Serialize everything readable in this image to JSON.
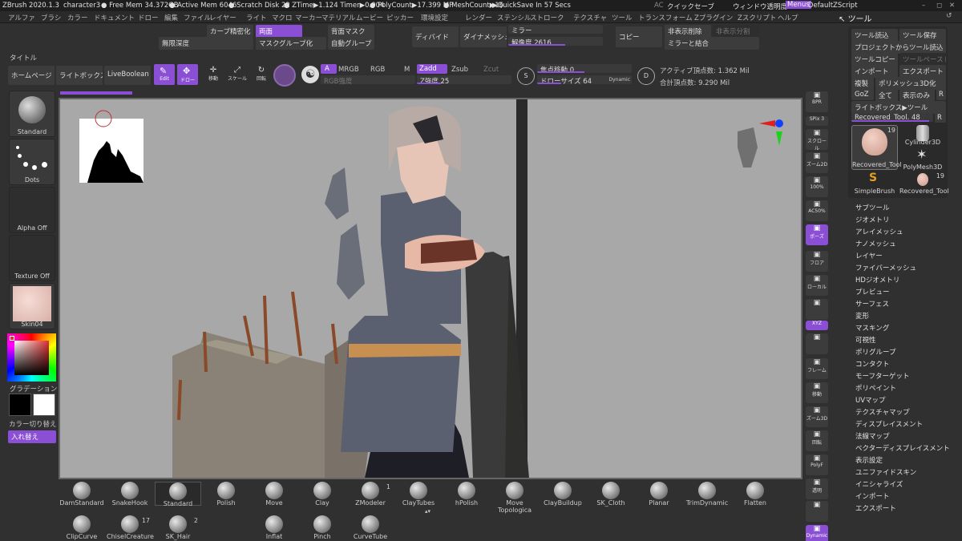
{
  "status": {
    "app": "ZBrush 2020.1.3",
    "doc": "character3",
    "free_mem": "● Free Mem 34.372GB",
    "active_mem": "● Active Mem 6046",
    "scratch": "● Scratch Disk 22",
    "ztime": "● ZTime▶1.124 Timer▶0.004",
    "polycount": "● PolyCount▶17.399 MP",
    "meshcount": "● MeshCount▶16",
    "quicksave": "▶QuickSave In 57 Secs",
    "ac": "AC",
    "quicksave_btn": "クイックセーブ",
    "transparency": "ウィンドウ透明度",
    "menus": "Menus",
    "script": "DefaultZScript"
  },
  "menu": [
    "アルファ",
    "ブラシ",
    "カラー",
    "ドキュメント",
    "ドロー",
    "編集",
    "ファイル",
    "レイヤー",
    "ライト",
    "マクロ",
    "マーカー",
    "マテリアル",
    "ムービー",
    "ピッカー",
    "環境設定",
    "レンダー",
    "ステンシル",
    "ストローク",
    "テクスチャ",
    "ツール",
    "トランスフォーム",
    "Zプラグイン",
    "Zスクリプト",
    "ヘルプ"
  ],
  "top": {
    "curve": "カーブ精密化",
    "both": "両面",
    "back_mask": "背面マスク",
    "nodepth": "無限深度",
    "maskgroup": "マスクグループ化",
    "autogroup": "自動グループ",
    "divide": "ディバイド",
    "dynamesh": "ダイナメッシュ",
    "mirror": "ミラー",
    "resolution": "解像度 2616",
    "copy": "コピー",
    "hide_delete": "非表示削除",
    "hide_split": "非表示分割",
    "mirror_merge": "ミラーと結合"
  },
  "title": "タイトル",
  "shelf": {
    "home": "ホームページ",
    "lightbox": "ライトボックス",
    "liveboolean": "LiveBoolean",
    "edit": "Edit",
    "draw": "ドロー",
    "move": "移動",
    "scale": "スケール",
    "rotate": "回転",
    "a": "A",
    "mrgb": "MRGB",
    "rgb": "RGB",
    "m": "M",
    "rgb_int": "RGB強度",
    "zadd": "Zadd",
    "zsub": "Zsub",
    "zcut": "Zcut",
    "zint": "Z強度 25",
    "focal": "焦点移動 0",
    "drawsize": "ドローサイズ 64",
    "dynamic": "Dynamic",
    "active_pts": "アクティブ頂点数: 1.362 Mil",
    "total_pts": "合計頂点数: 9.290 Mil"
  },
  "left": {
    "brush": "Standard",
    "stroke": "Dots",
    "alpha": "Alpha Off",
    "texture": "Texture Off",
    "material": "Skin04",
    "gradient": "グラデーション",
    "swap": "カラー切り替え",
    "swap2": "入れ替え"
  },
  "right_icons": [
    "BPR",
    "SPix 3",
    "スクロール",
    "ズーム2D",
    "100%",
    "AC50%",
    "ポーズ",
    "フロア",
    "ローカル",
    "",
    "XYZ",
    "",
    "フレーム",
    "移動",
    "ズーム3D",
    "回転",
    "PolyF",
    "透明",
    "",
    "Dynamic"
  ],
  "tool": {
    "header": "ツール",
    "load": "ツール読込",
    "save": "ツール保存",
    "proj": "プロジェクトからツール読込",
    "copy": "ツールコピー",
    "paste": "ツールペースト",
    "import": "インポート",
    "export": "エクスポート",
    "clone": "複製",
    "polymesh": "ポリメッシュ3D化",
    "goz": "GoZ",
    "all": "全て",
    "visible": "表示のみ",
    "r": "R",
    "lb": "ライトボックス▶ツール",
    "current": "Recovered_Tool. 48",
    "r2": "R",
    "items": [
      {
        "name": "Recovered_Tool",
        "count": "19"
      },
      {
        "name": "Cylinder3D",
        "count": ""
      },
      {
        "name": "PolyMesh3D",
        "count": ""
      },
      {
        "name": "SimpleBrush",
        "count": ""
      },
      {
        "name": "Recovered_Tool",
        "count": "19"
      }
    ],
    "menu": [
      "サブツール",
      "ジオメトリ",
      "アレイメッシュ",
      "ナノメッシュ",
      "レイヤー",
      "ファイバーメッシュ",
      "HDジオメトリ",
      "プレビュー",
      "サーフェス",
      "変形",
      "マスキング",
      "可視性",
      "ポリグループ",
      "コンタクト",
      "モーフターゲット",
      "ポリペイント",
      "UVマップ",
      "テクスチャマップ",
      "ディスプレイスメント",
      "法線マップ",
      "ベクターディスプレイスメント",
      "表示設定",
      "ユニファイドスキン",
      "イニシャライズ",
      "インポート",
      "エクスポート"
    ]
  },
  "brushes_row1": [
    {
      "n": "DamStandard",
      "c": ""
    },
    {
      "n": "SnakeHook",
      "c": ""
    },
    {
      "n": "Standard",
      "c": ""
    },
    {
      "n": "Polish",
      "c": ""
    },
    {
      "n": "Move",
      "c": ""
    },
    {
      "n": "Clay",
      "c": ""
    },
    {
      "n": "ZModeler",
      "c": "1"
    },
    {
      "n": "ClayTubes",
      "c": ""
    },
    {
      "n": "hPolish",
      "c": ""
    },
    {
      "n": "Move Topologica",
      "c": ""
    },
    {
      "n": "ClayBuildup",
      "c": ""
    },
    {
      "n": "SK_Cloth",
      "c": ""
    },
    {
      "n": "Planar",
      "c": ""
    },
    {
      "n": "TrimDynamic",
      "c": ""
    },
    {
      "n": "Flatten",
      "c": ""
    }
  ],
  "brushes_row2": [
    {
      "n": "ClipCurve",
      "c": ""
    },
    {
      "n": "ChiselCreature",
      "c": "17"
    },
    {
      "n": "SK_Hair",
      "c": "2"
    },
    {
      "n": "Inflat",
      "c": ""
    },
    {
      "n": "Pinch",
      "c": ""
    },
    {
      "n": "CurveTube",
      "c": ""
    }
  ]
}
